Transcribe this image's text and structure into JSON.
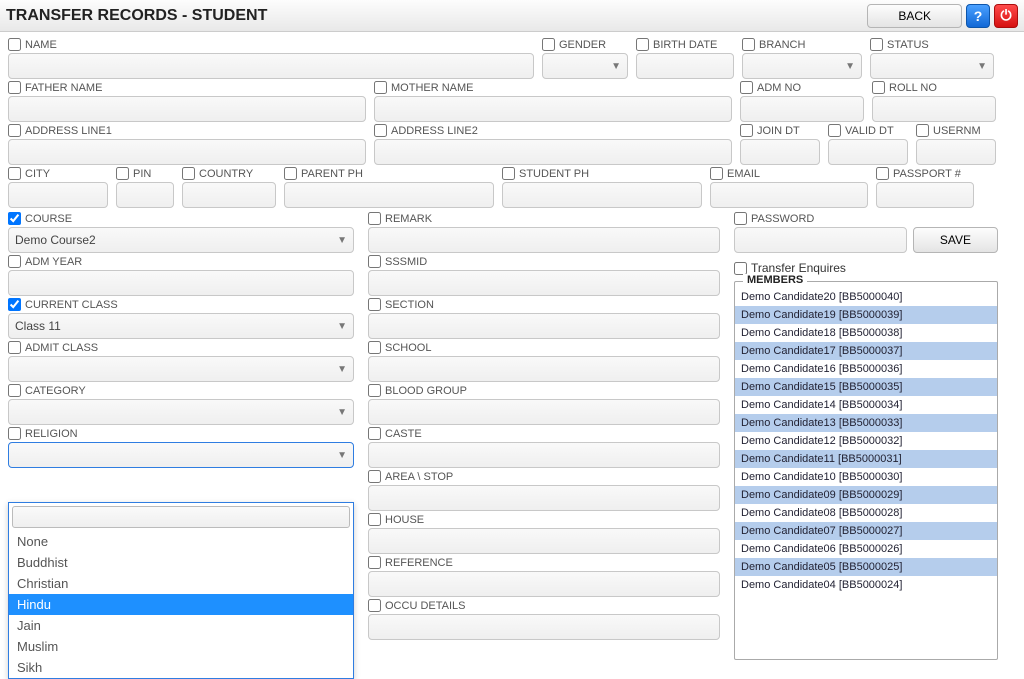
{
  "header": {
    "title": "TRANSFER RECORDS - STUDENT",
    "back_label": "BACK"
  },
  "fields": {
    "name": "NAME",
    "gender": "GENDER",
    "birth_date": "BIRTH DATE",
    "branch": "BRANCH",
    "status": "STATUS",
    "father_name": "FATHER NAME",
    "mother_name": "MOTHER NAME",
    "adm_no": "ADM NO",
    "roll_no": "ROLL NO",
    "address_line1": "ADDRESS LINE1",
    "address_line2": "ADDRESS LINE2",
    "join_dt": "JOIN DT",
    "valid_dt": "VALID DT",
    "usernm": "USERNM",
    "city": "CITY",
    "pin": "PIN",
    "country": "COUNTRY",
    "parent_ph": "PARENT PH",
    "student_ph": "STUDENT PH",
    "email": "EMAIL",
    "passport": "PASSPORT #",
    "course": "COURSE",
    "course_value": "Demo Course2",
    "adm_year": "ADM YEAR",
    "current_class": "CURRENT CLASS",
    "current_class_value": "Class 11",
    "admit_class": "ADMIT CLASS",
    "category": "CATEGORY",
    "religion": "RELIGION",
    "remark": "REMARK",
    "sssmid": "SSSMID",
    "section": "SECTION",
    "school": "SCHOOL",
    "blood_group": "BLOOD GROUP",
    "caste": "CASTE",
    "area_stop": "AREA \\ STOP",
    "house": "HOUSE",
    "reference": "REFERENCE",
    "occu_details": "OCCU DETAILS",
    "password": "PASSWORD",
    "save_label": "SAVE",
    "transfer_enquires": "Transfer Enquires",
    "members_caption": "MEMBERS"
  },
  "religion_options": [
    "None",
    "Buddhist",
    "Christian",
    "Hindu",
    "Jain",
    "Muslim",
    "Sikh"
  ],
  "religion_selected": "Hindu",
  "members": [
    "Demo Candidate20 [BB5000040]",
    "Demo Candidate19 [BB5000039]",
    "Demo Candidate18 [BB5000038]",
    "Demo Candidate17 [BB5000037]",
    "Demo Candidate16 [BB5000036]",
    "Demo Candidate15 [BB5000035]",
    "Demo Candidate14 [BB5000034]",
    "Demo Candidate13 [BB5000033]",
    "Demo Candidate12 [BB5000032]",
    "Demo Candidate11 [BB5000031]",
    "Demo Candidate10 [BB5000030]",
    "Demo Candidate09 [BB5000029]",
    "Demo Candidate08 [BB5000028]",
    "Demo Candidate07 [BB5000027]",
    "Demo Candidate06 [BB5000026]",
    "Demo Candidate05 [BB5000025]",
    "Demo Candidate04 [BB5000024]"
  ]
}
